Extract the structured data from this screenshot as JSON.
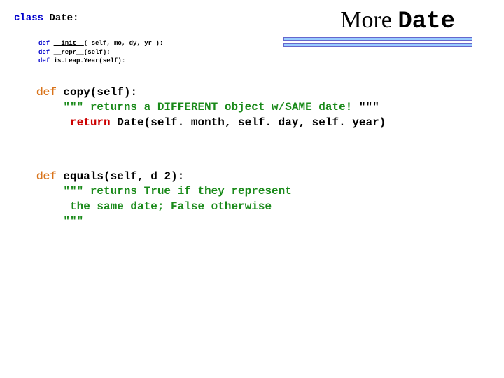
{
  "classDecl": {
    "kw": "class",
    "name": " Date:"
  },
  "title": {
    "prefix": "More ",
    "mono": "Date"
  },
  "smallDefs": {
    "line1": {
      "kw": "def ",
      "name": "__init__",
      "args": "( self, mo, dy, yr ):"
    },
    "line2": {
      "kw": "def ",
      "name": "__repr__",
      "args": "(self):"
    },
    "line3": {
      "kw": "def ",
      "rest": "is.Leap.Year(self):"
    }
  },
  "copy": {
    "def": "def",
    "sig": " copy(self):",
    "doc1a": "\"\"\" returns a DIFFERENT object w/SAME date! ",
    "doc1b": "\"\"\"",
    "retKw": " return ",
    "retExpr": "Date(self. month, self. day, self. year)"
  },
  "equals": {
    "def": "def",
    "sig": " equals(self, d 2):",
    "doc1a": "\"\"\" returns True if ",
    "docThey": "they",
    "doc1b": " represent",
    "doc2": "    the same date; False otherwise",
    "doc3": "\"\"\""
  }
}
